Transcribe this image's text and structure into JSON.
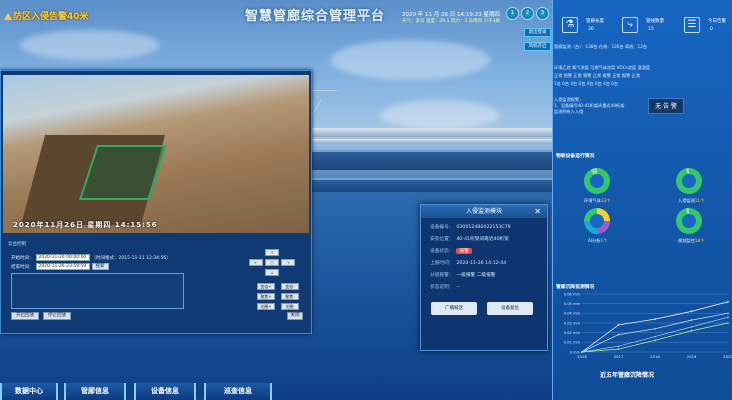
{
  "header": {
    "title": "智慧管廊综合管理平台",
    "alarm": "防区入侵告警40米",
    "datetime": "2020 年 11 月 26 日 14:19:23 星期四",
    "weather": "天气：多云 温度：29.1 风力：3 东南风 小于3级",
    "topbuttons": [
      "1",
      "2",
      "3"
    ],
    "side_tags": [
      "退出登录",
      "风机开启"
    ]
  },
  "video": {
    "osd": "2020年11月26日 星期四 14:15:56"
  },
  "controls": {
    "title": "云台控制",
    "start_label": "开始时间：",
    "start_value": "2020-11-26 00:00:00",
    "start_hint": "（时间格式：2015-11-11 12:34:56）",
    "end_label": "结束时间：",
    "end_value": "2020-11-26 23:59:59",
    "search_btn": "搜索",
    "pad": {
      "up": "↑",
      "left": "←",
      "center": "○",
      "right": "→",
      "down": "↓",
      "zoom_in": "变倍+",
      "zoom_out": "变倍-",
      "focus_in": "聚焦+",
      "focus_out": "聚焦-",
      "iris_in": "光圈+",
      "iris_out": "光圈-"
    },
    "btn_open": "开启回放",
    "btn_stop": "停止回放",
    "btn_close": "关闭"
  },
  "modal": {
    "title": "入侵监测模块",
    "close": "✕",
    "rows": [
      {
        "label": "设备编号：",
        "value": "0300124B0022153C79"
      },
      {
        "label": "安装位置：",
        "value": "40-41桁架间靠近40桁架"
      },
      {
        "label": "设备状态：",
        "value": "报警"
      },
      {
        "label": "上报时间：",
        "value": "2020-11-26 14:12:44"
      },
      {
        "label": "分级报警：",
        "value": "一级报警 二级报警"
      },
      {
        "label": "状态说明：",
        "value": "--"
      }
    ],
    "btn_broadcast": "广播喊话",
    "btn_device": "设备复位"
  },
  "right": {
    "kpis": [
      {
        "icon": "⚗",
        "label": "管廊长度",
        "value": "30"
      },
      {
        "icon": "⤷",
        "label": "管线数量",
        "value": "15"
      },
      {
        "icon": "☰",
        "label": "今日告警",
        "value": "0"
      }
    ],
    "status_line": "管廊监测（台）：138台  在线：126台  离线：12台",
    "sensor_row1": "环境乙烷   氧气浓度   可燃气体浓度   VOCs浓度   温湿度",
    "sensor_row2": "正常 报警   正常 报警   正常 报警   正常 报警   正常",
    "sensor_row3": "1台  0台   4台  0台   4台  0台   4台  0台",
    "alarm_line1": "入侵监测报警，",
    "alarm_line2": "1、设备编号40-41桁架间靠近40桁架",
    "alarm_line3": "监测到有人入侵",
    "play": "无 告 警",
    "donut_title": "物联设备运行情况",
    "donuts": [
      {
        "label": "环境气体",
        "num": "33个"
      },
      {
        "label": "入侵监测",
        "num": "11个"
      },
      {
        "label": "AI分析",
        "num": "1个"
      },
      {
        "label": "视频监控",
        "num": "18个"
      }
    ],
    "chart_heading": "管廊沉降监测情况",
    "chart_title": "近五年管廊沉降情况"
  },
  "chart_data": {
    "type": "line",
    "x": [
      "2016",
      "2017",
      "2018",
      "2019",
      "2020"
    ],
    "yticks": [
      "0.06 mm",
      "0.05 mm",
      "0.04 mm",
      "0.03 mm",
      "0.02 mm",
      "0.01 mm",
      "0 mm"
    ],
    "ylim": [
      0,
      0.06
    ],
    "series": [
      {
        "values": [
          0.0,
          0.028,
          0.034,
          0.042,
          0.052
        ]
      },
      {
        "values": [
          0.0,
          0.018,
          0.024,
          0.033,
          0.04
        ]
      },
      {
        "values": [
          0.0,
          0.006,
          0.016,
          0.026,
          0.036
        ]
      },
      {
        "values": [
          0.0,
          0.003,
          0.012,
          0.022,
          0.03
        ]
      }
    ]
  },
  "nav": [
    "数据中心",
    "管廊信息",
    "设备信息",
    "巡查信息"
  ]
}
